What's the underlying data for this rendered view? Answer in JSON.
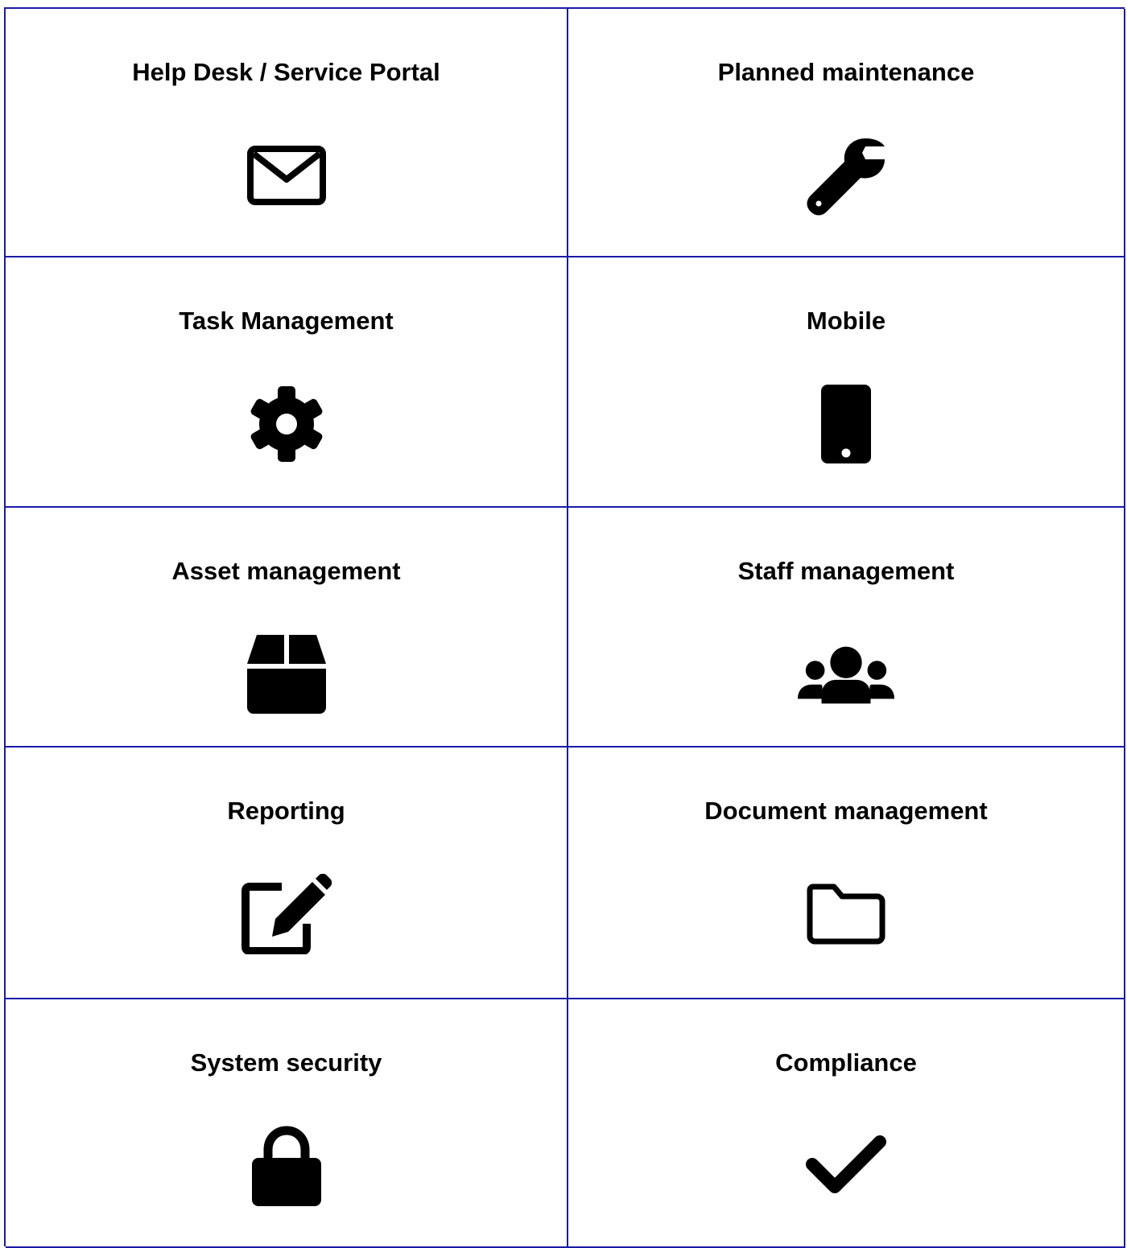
{
  "features": [
    {
      "title": "Help Desk / Service Portal",
      "icon": "envelope-icon"
    },
    {
      "title": "Planned maintenance",
      "icon": "wrench-icon"
    },
    {
      "title": "Task Management",
      "icon": "gear-icon"
    },
    {
      "title": "Mobile",
      "icon": "mobile-phone-icon"
    },
    {
      "title": "Asset management",
      "icon": "box-icon"
    },
    {
      "title": "Staff management",
      "icon": "users-icon"
    },
    {
      "title": "Reporting",
      "icon": "edit-icon"
    },
    {
      "title": "Document management",
      "icon": "folder-icon"
    },
    {
      "title": "System security",
      "icon": "lock-icon"
    },
    {
      "title": "Compliance",
      "icon": "checkmark-icon"
    }
  ],
  "colors": {
    "border": "#1a1aa8",
    "icon": "#000000",
    "text": "#000000",
    "background": "#ffffff"
  }
}
